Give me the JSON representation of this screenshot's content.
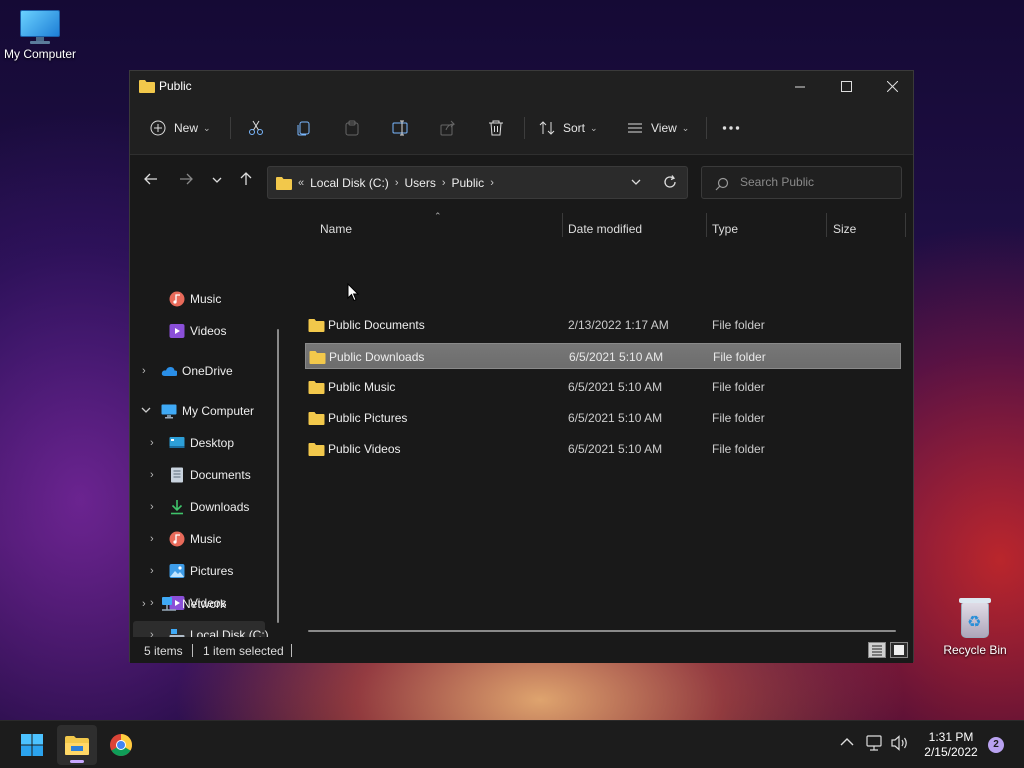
{
  "desktop": {
    "my_computer_label": "My Computer",
    "recycle_bin_label": "Recycle Bin"
  },
  "window": {
    "title": "Public",
    "commands": {
      "new_label": "New",
      "sort_label": "Sort",
      "view_label": "View"
    },
    "address": {
      "overflow": "«",
      "crumbs": [
        "Local Disk (C:)",
        "Users",
        "Public"
      ]
    },
    "search": {
      "placeholder": "Search Public"
    },
    "nav": {
      "items": [
        {
          "label": "Music",
          "icon": "music-icon"
        },
        {
          "label": "Videos",
          "icon": "videos-icon"
        },
        {
          "label": "OneDrive",
          "icon": "onedrive-icon"
        },
        {
          "label": "My Computer",
          "icon": "computer-icon"
        },
        {
          "label": "Desktop",
          "icon": "desktop-icon"
        },
        {
          "label": "Documents",
          "icon": "documents-icon"
        },
        {
          "label": "Downloads",
          "icon": "downloads-icon"
        },
        {
          "label": "Music",
          "icon": "music-icon"
        },
        {
          "label": "Pictures",
          "icon": "pictures-icon"
        },
        {
          "label": "Videos",
          "icon": "videos-icon"
        },
        {
          "label": "Local Disk (C:)",
          "icon": "drive-icon"
        },
        {
          "label": "Network",
          "icon": "network-icon"
        }
      ]
    },
    "columns": {
      "name": "Name",
      "date": "Date modified",
      "type": "Type",
      "size": "Size"
    },
    "files": [
      {
        "name": "Public Documents",
        "date": "2/13/2022 1:17 AM",
        "type": "File folder"
      },
      {
        "name": "Public Downloads",
        "date": "6/5/2021 5:10 AM",
        "type": "File folder"
      },
      {
        "name": "Public Music",
        "date": "6/5/2021 5:10 AM",
        "type": "File folder"
      },
      {
        "name": "Public Pictures",
        "date": "6/5/2021 5:10 AM",
        "type": "File folder"
      },
      {
        "name": "Public Videos",
        "date": "6/5/2021 5:10 AM",
        "type": "File folder"
      }
    ],
    "status": {
      "item_count": "5 items",
      "selection": "1 item selected"
    }
  },
  "taskbar": {
    "time": "1:31 PM",
    "date": "2/15/2022",
    "notification_count": "2"
  },
  "colors": {
    "folder": "#f2c84b",
    "accent": "#c8a7ff"
  }
}
